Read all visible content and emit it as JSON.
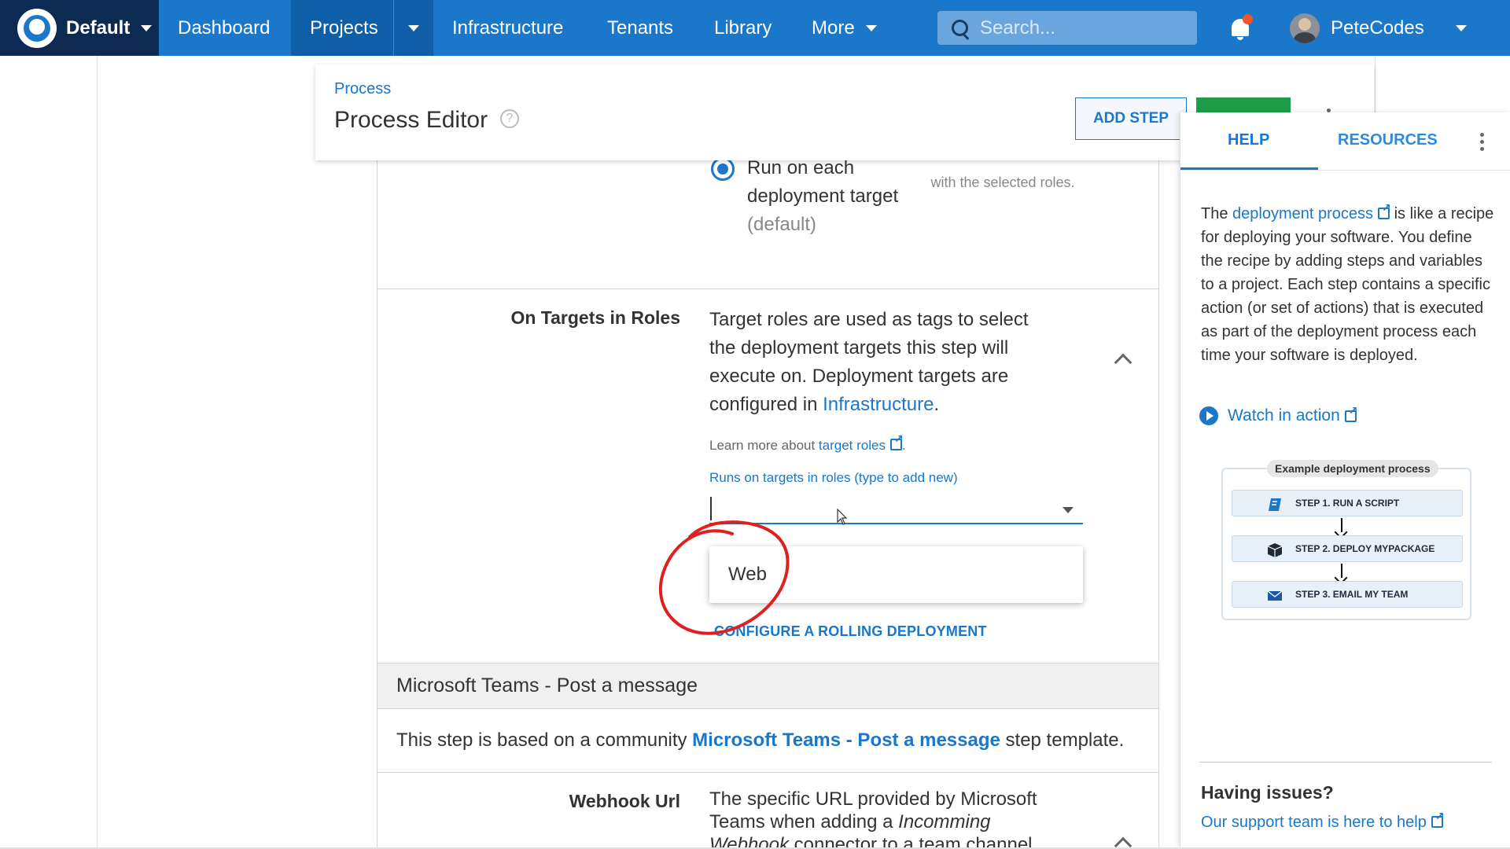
{
  "nav": {
    "space_name": "Default",
    "items": [
      {
        "label": "Dashboard"
      },
      {
        "label": "Projects"
      },
      {
        "label": "Infrastructure"
      },
      {
        "label": "Tenants"
      },
      {
        "label": "Library"
      },
      {
        "label": "More"
      }
    ],
    "search_placeholder": "Search...",
    "username": "PeteCodes",
    "colors": {
      "bar": "#1a77ca",
      "space": "#0d2a52",
      "active": "#0f5ea8",
      "notification_dot": "#f2552c"
    }
  },
  "header": {
    "breadcrumb": "Process",
    "title": "Process Editor",
    "add_step_label": "ADD STEP"
  },
  "radio": {
    "label": "Run on each deployment target",
    "default_suffix": "(default)",
    "faded_hint": "with the selected roles."
  },
  "roles": {
    "title": "On Targets in Roles",
    "description_before_link": "Target roles are used as tags to select the deployment targets this step will execute on. Deployment targets are configured in ",
    "description_link": "Infrastructure",
    "description_after_link": ".",
    "learn_more_prefix": "Learn more about ",
    "learn_more_link": "target roles",
    "learn_more_suffix": ".",
    "field_label": "Runs on targets in roles (type to add new)",
    "input_value": "",
    "suggestion": "Web",
    "rolling_link": "CONFIGURE A ROLLING DEPLOYMENT"
  },
  "teams": {
    "header": "Microsoft Teams - Post a message",
    "desc_before": "This step is based on a community ",
    "desc_link": "Microsoft Teams - Post a message",
    "desc_after": " step template."
  },
  "webhook": {
    "title": "Webhook Url",
    "desc_part1": "The specific URL provided by Microsoft Teams when adding a ",
    "desc_em": "Incomming Webhook",
    "desc_part2": " connector to a team channel."
  },
  "help_panel": {
    "tabs": [
      {
        "label": "HELP"
      },
      {
        "label": "RESOURCES"
      }
    ],
    "text_before_link": "The ",
    "text_link": "deployment process",
    "text_after_link": " is like a recipe for deploying your software. You define the recipe by adding steps and variables to a project. Each step contains a specific action (or set of actions) that is executed as part of the deployment process each time your software is deployed.",
    "watch_label": "Watch in action",
    "diagram": {
      "title": "Example deployment process",
      "steps": [
        {
          "label": "STEP 1. RUN A SCRIPT",
          "icon": "script-icon"
        },
        {
          "label": "STEP 2. DEPLOY MYPACKAGE",
          "icon": "package-icon"
        },
        {
          "label": "STEP 3. EMAIL MY TEAM",
          "icon": "email-icon"
        }
      ]
    },
    "issues_title": "Having issues?",
    "issues_link": "Our support team is here to help"
  },
  "annotation_color": "#e0201f"
}
